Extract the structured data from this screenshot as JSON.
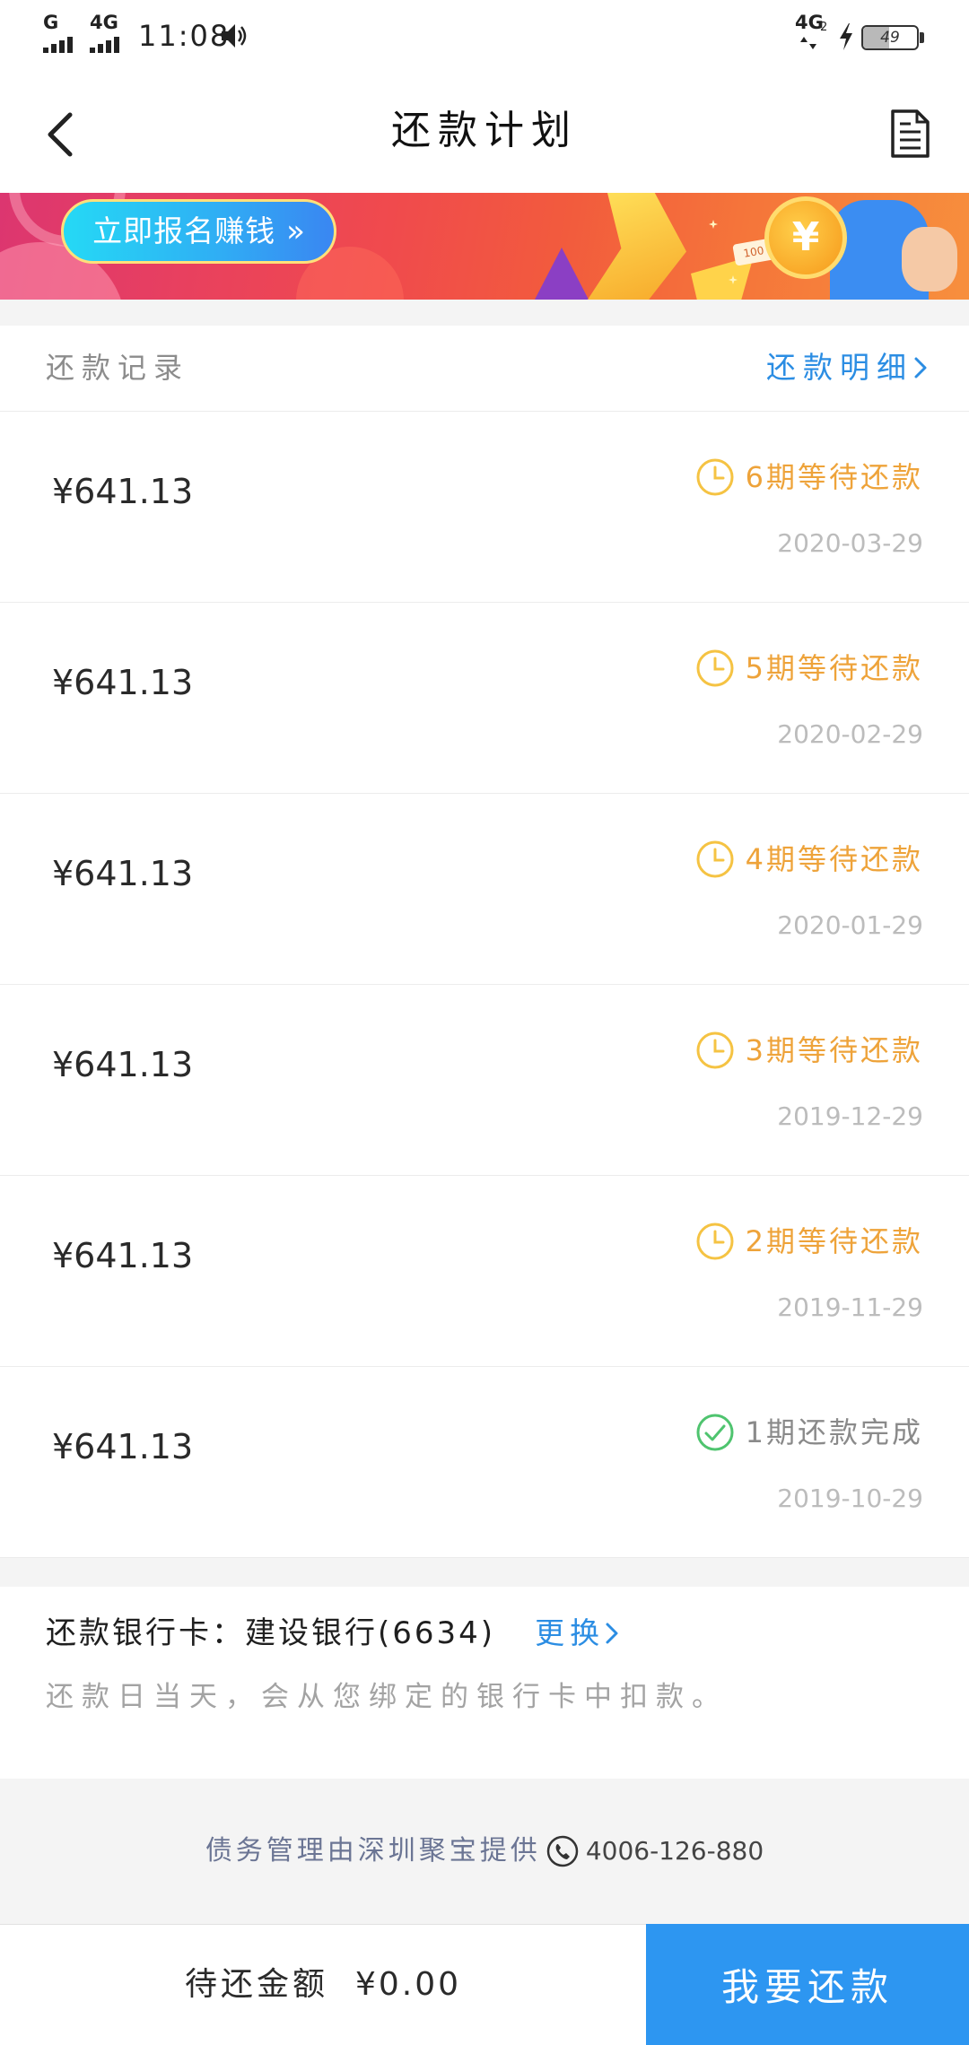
{
  "status_bar": {
    "signal_1_label": "G",
    "signal_2_label": "4G",
    "time": "11:08",
    "right_network": "4G",
    "right_network_sub": "2",
    "battery_level": "49",
    "icons": [
      "signal-bars-icon",
      "speaker-icon",
      "data-arrows-icon",
      "charging-bolt-icon",
      "battery-icon"
    ]
  },
  "header": {
    "title": "还款计划",
    "icons": {
      "back": "back-arrow-icon",
      "document": "document-icon"
    }
  },
  "banner": {
    "button_label": "立即报名赚钱",
    "button_chevron": "»",
    "coin_symbol": "¥",
    "card_value": "100"
  },
  "records_header": {
    "title": "还款记录",
    "detail_link": "还款明细",
    "detail_icon": "chevron-right-icon"
  },
  "installments": [
    {
      "amount": "¥641.13",
      "status": "6期等待还款",
      "date": "2020-03-29",
      "icon": "clock-icon"
    },
    {
      "amount": "¥641.13",
      "status": "5期等待还款",
      "date": "2020-02-29",
      "icon": "clock-icon"
    },
    {
      "amount": "¥641.13",
      "status": "4期等待还款",
      "date": "2020-01-29",
      "icon": "clock-icon"
    },
    {
      "amount": "¥641.13",
      "status": "3期等待还款",
      "date": "2019-12-29",
      "icon": "clock-icon"
    },
    {
      "amount": "¥641.13",
      "status": "2期等待还款",
      "date": "2019-11-29",
      "icon": "clock-icon"
    },
    {
      "amount": "¥641.13",
      "status": "1期还款完成",
      "date": "2019-10-29",
      "icon": "check-circle-icon"
    }
  ],
  "bank_card": {
    "label": "还款银行卡：",
    "card": "建设银行(6634)",
    "change_link": "更换",
    "note": "还款日当天，会从您绑定的银行卡中扣款。"
  },
  "service_info": {
    "provider": "债务管理由深圳聚宝提供",
    "phone": "4006-126-880",
    "icon": "phone-icon"
  },
  "bottom_bar": {
    "due_label": "待还金额",
    "due_amount": "¥0.00",
    "pay_button": "我要还款"
  },
  "colors": {
    "accent_blue": "#2d96f1",
    "link_blue": "#2b8de3",
    "pending_text": "#eea33a",
    "pending_icon": "#f5c343",
    "done_icon": "#4fc46f",
    "muted_gray": "#a3a3a3",
    "date_gray": "#bcbcbc",
    "page_bg": "#f4f4f4"
  }
}
